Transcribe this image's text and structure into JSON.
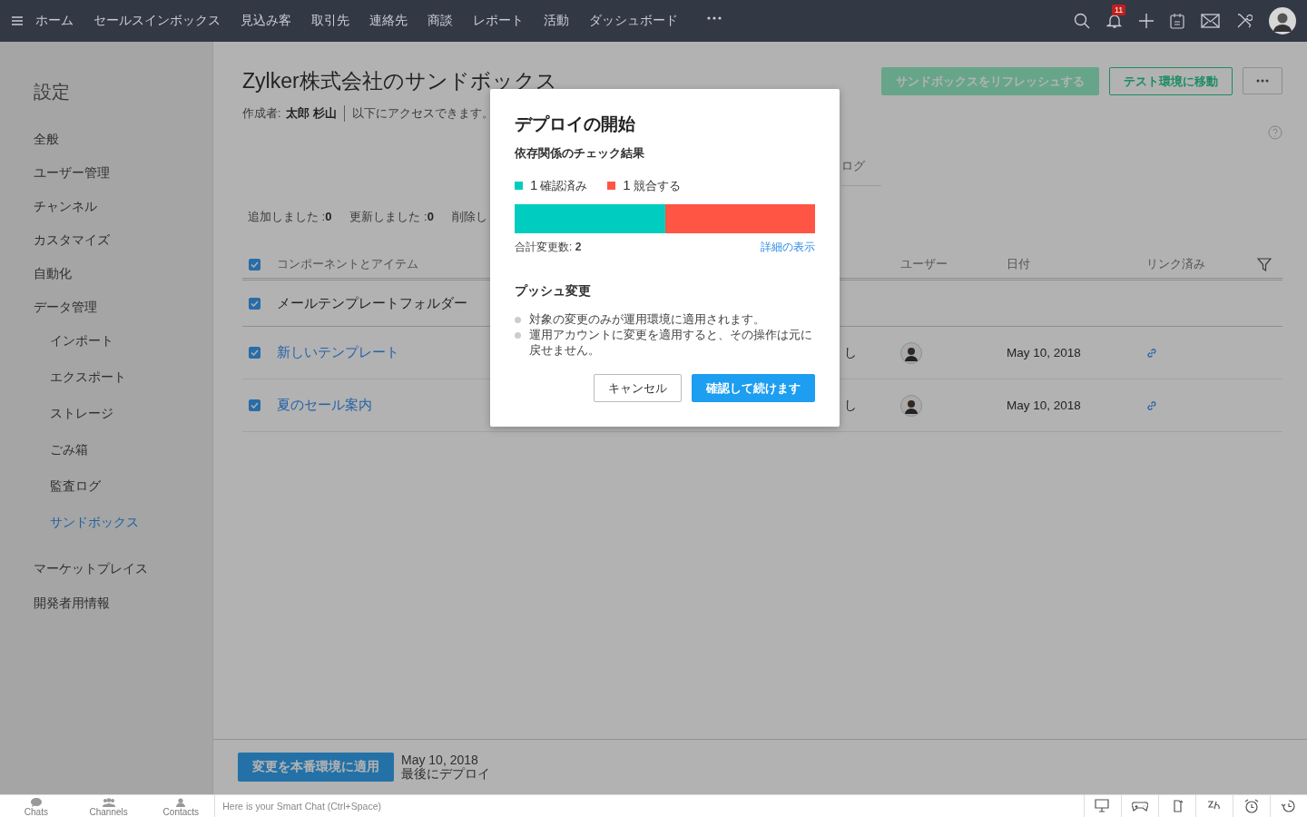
{
  "top_nav": {
    "items": [
      "ホーム",
      "セールスインボックス",
      "見込み客",
      "取引先",
      "連絡先",
      "商談",
      "レポート",
      "活動",
      "ダッシュボード"
    ],
    "notification_count": "11"
  },
  "sidebar": {
    "title": "設定",
    "items": [
      {
        "label": "全般",
        "selected": false
      },
      {
        "label": "ユーザー管理",
        "selected": false
      },
      {
        "label": "チャンネル",
        "selected": false
      },
      {
        "label": "カスタマイズ",
        "selected": false
      },
      {
        "label": "自動化",
        "selected": false
      },
      {
        "label": "データ管理",
        "selected": false,
        "children": [
          {
            "label": "インポート",
            "selected": false
          },
          {
            "label": "エクスポート",
            "selected": false
          },
          {
            "label": "ストレージ",
            "selected": false
          },
          {
            "label": "ごみ箱",
            "selected": false
          },
          {
            "label": "監査ログ",
            "selected": false
          },
          {
            "label": "サンドボックス",
            "selected": true
          }
        ]
      },
      {
        "label": "マーケットプレイス",
        "selected": false
      },
      {
        "label": "開発者用情報",
        "selected": false
      }
    ]
  },
  "header": {
    "title": "Zylker株式会社のサンドボックス",
    "author_label": "作成者:",
    "author": "太郎 杉山",
    "access": "以下にアクセスできます。",
    "buttons": [
      {
        "label": "サンドボックスをリフレッシュする",
        "kind": "filled",
        "disabled": true
      },
      {
        "label": "テスト環境に移動",
        "kind": "outline",
        "disabled": false
      }
    ]
  },
  "tabs": [
    "ログ"
  ],
  "counts": [
    {
      "label": "追加しました :",
      "value": "0"
    },
    {
      "label": "更新しました :",
      "value": "0"
    },
    {
      "label": "削除し"
    }
  ],
  "table": {
    "columns": [
      "コンポーネントとアイテム",
      "ユーザー",
      "日付",
      "リンク済み"
    ],
    "header_checked": true,
    "rows": [
      {
        "kind": "folder",
        "name": "メールテンプレートフォルダー",
        "checked": true
      },
      {
        "kind": "item",
        "name": "新しいテンプレート",
        "checked": true,
        "column_3": "し",
        "date": "May 10, 2018"
      },
      {
        "kind": "item",
        "name": "夏のセール案内",
        "checked": true,
        "column_3": "し",
        "date": "May 10, 2018"
      }
    ]
  },
  "deploy_bar": {
    "button": "変更を本番環境に適用",
    "date": "May 10, 2018",
    "caption": "最後にデプロイ"
  },
  "modal": {
    "title": "デプロイの開始",
    "subtitle": "依存関係のチェック結果",
    "legend": [
      {
        "count": "1",
        "label": "確認済み",
        "color": "#00cdc0"
      },
      {
        "count": "1",
        "label": "競合する",
        "color": "#ff5544"
      }
    ],
    "bar": {
      "level": 0.5
    },
    "total_label": "合計変更数:",
    "total": "2",
    "details_link": "詳細の表示",
    "section_title": "プッシュ変更",
    "notes": [
      "対象の変更のみが運用環境に適用されます。",
      "運用アカウントに変更を適用すると、その操作は元に戻せません。"
    ],
    "buttons": [
      {
        "label": "キャンセル",
        "kind": "secondary"
      },
      {
        "label": "確認して続けます",
        "kind": "primary"
      }
    ]
  },
  "chat_bar": {
    "tabs": [
      "Chats",
      "Channels",
      "Contacts"
    ],
    "placeholder": "Here is your Smart Chat (Ctrl+Space)"
  }
}
